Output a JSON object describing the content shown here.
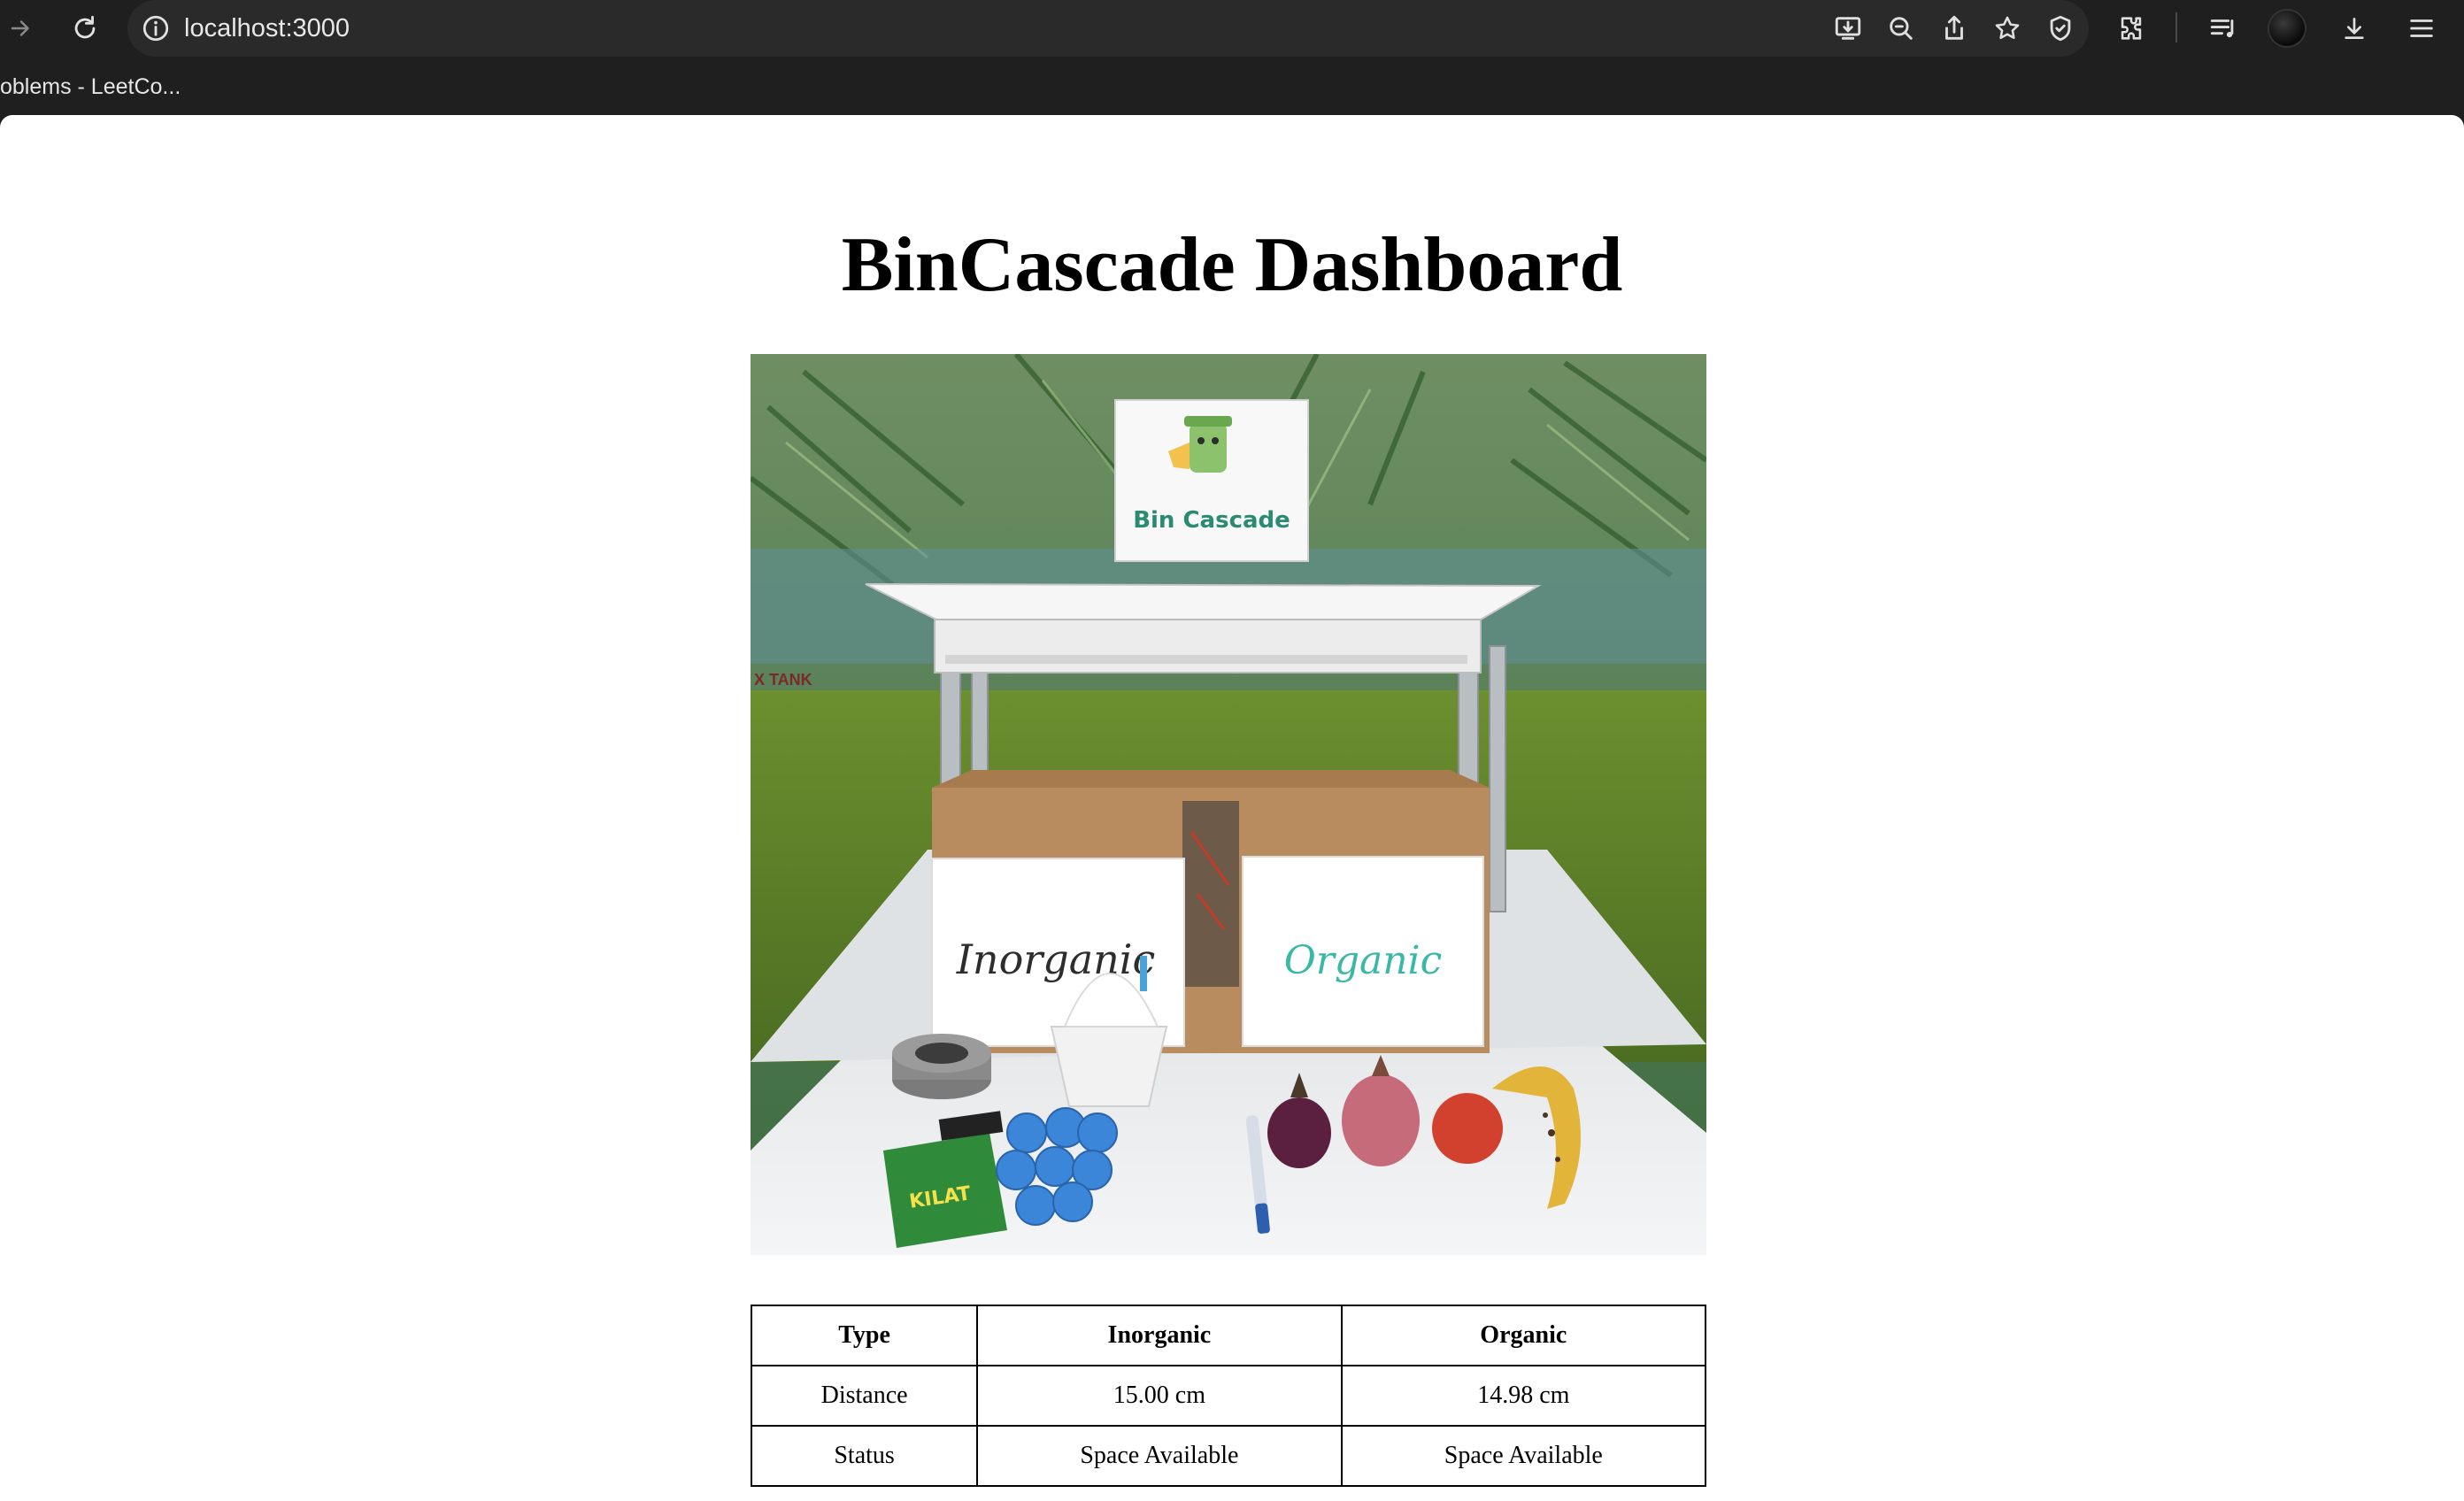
{
  "browser": {
    "url": "localhost:3000",
    "bookmark_label": "oblems - LeetCo...",
    "icons": [
      "forward-icon",
      "reload-icon",
      "site-info-icon",
      "install-app-icon",
      "zoom-out-icon",
      "share-icon",
      "bookmark-star-icon",
      "shield-icon",
      "extensions-icon",
      "reading-list-icon",
      "profile-avatar",
      "downloads-icon",
      "menu-icon"
    ]
  },
  "page": {
    "title": "BinCascade Dashboard",
    "photo": {
      "sign_text": "Bin Cascade",
      "left_label": "Inorganic",
      "right_label": "Organic",
      "background_sign": "X TANK"
    }
  },
  "table": {
    "headers": [
      "Type",
      "Inorganic",
      "Organic"
    ],
    "rows": [
      [
        "Distance",
        "15.00 cm",
        "14.98 cm"
      ],
      [
        "Status",
        "Space Available",
        "Space Available"
      ]
    ]
  },
  "colors": {
    "chrome_bg": "#1f1f1f",
    "urlbar_bg": "#2a2a2a",
    "page_bg": "#ffffff"
  }
}
